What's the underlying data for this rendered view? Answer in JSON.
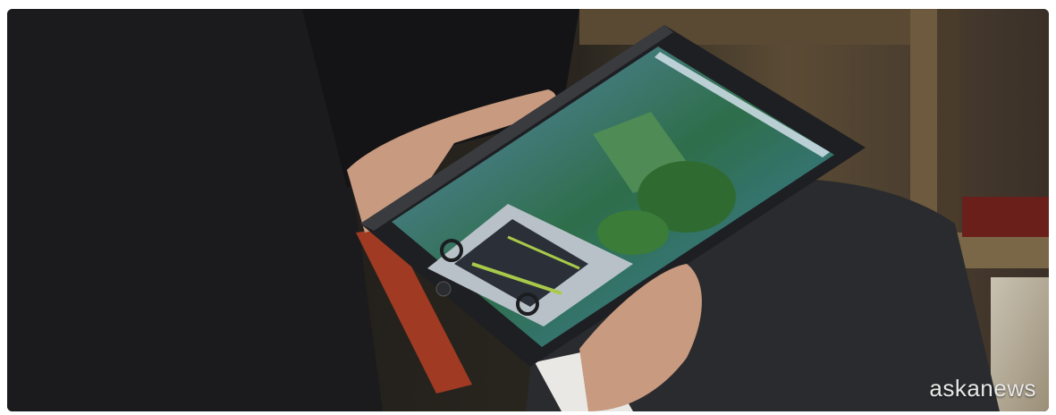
{
  "watermark": "askanews"
}
